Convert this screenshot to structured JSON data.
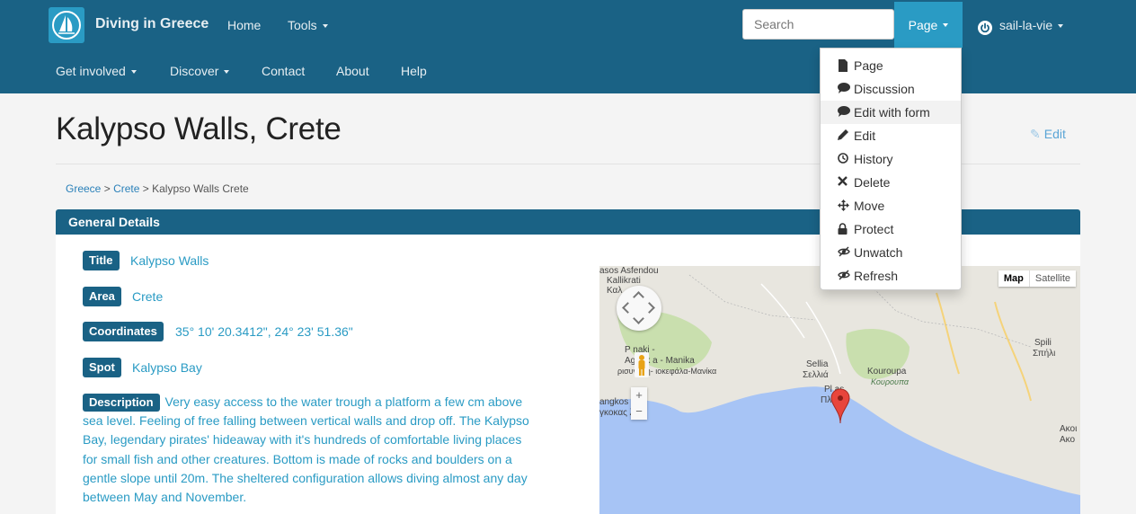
{
  "navbar": {
    "brand": "Diving in Greece",
    "primary": [
      {
        "label": "Home",
        "has_caret": false
      },
      {
        "label": "Tools",
        "has_caret": true
      }
    ],
    "secondary": [
      {
        "label": "Get involved",
        "has_caret": true
      },
      {
        "label": "Discover",
        "has_caret": true
      },
      {
        "label": "Contact",
        "has_caret": false
      },
      {
        "label": "About",
        "has_caret": false
      },
      {
        "label": "Help",
        "has_caret": false
      }
    ],
    "search_placeholder": "Search",
    "page_button": "Page",
    "user": "sail-la-vie"
  },
  "page_menu": {
    "items": [
      {
        "label": "Page",
        "icon": "file-icon"
      },
      {
        "label": "Discussion",
        "icon": "comment-icon"
      },
      {
        "label": "Edit with form",
        "icon": "comment-icon",
        "highlighted": true
      },
      {
        "label": "Edit",
        "icon": "pencil-icon"
      },
      {
        "label": "History",
        "icon": "clock-icon"
      },
      {
        "label": "Delete",
        "icon": "remove-icon"
      },
      {
        "label": "Move",
        "icon": "move-icon"
      },
      {
        "label": "Protect",
        "icon": "lock-icon"
      },
      {
        "label": "Unwatch",
        "icon": "eye-slash-icon"
      },
      {
        "label": "Refresh",
        "icon": "eye-slash-icon"
      }
    ]
  },
  "header": {
    "title": "Kalypso Walls, Crete",
    "edit_label": "Edit"
  },
  "breadcrumb": {
    "items": [
      "Greece",
      "Crete",
      "Kalypso Walls Crete"
    ],
    "separator": ">"
  },
  "section": {
    "title": "General Details",
    "fields": {
      "title": {
        "label": "Title",
        "value": "Kalypso Walls"
      },
      "area": {
        "label": "Area",
        "value": "Crete"
      },
      "coordinates": {
        "label": "Coordinates",
        "value": "35° 10' 20.3412\", 24° 23' 51.36\""
      },
      "spot": {
        "label": "Spot",
        "value": "Kalypso Bay"
      },
      "description": {
        "label": "Description",
        "value": "Very easy access to the water trough a platform a few cm above sea level. Feeling of free falling between vertical walls and drop off. The Kalypso Bay, legendary pirates' hideaway with it's hundreds of comfortable living places for small fish and other creatures. Bottom is made of rocks and boulders on a gentle slope until 20m. The sheltered configuration allows diving almost any day between May and November."
      }
    }
  },
  "map": {
    "type_map": "Map",
    "type_satellite": "Satellite",
    "zoom_in": "+",
    "zoom_out": "−",
    "labels": {
      "asfendou": "asos Asfendou",
      "kallikrati": "Kallikrati",
      "kali": "Καλ",
      "peristeraki": "P      naki -",
      "agriokefala": "Agriok      a - Manika",
      "agriokefala_gr": "ρισυνάκη-   ιοκεφάλα-Μανίκα",
      "sellia": "Sellia",
      "sellia_gr": "Σελλιά",
      "kouroupa": "Kouroupa",
      "kouroupa_gr": "Κουρουπα",
      "spili": "Spili",
      "spili_gr": "Σπήλι",
      "plakias": "Pl    as",
      "plakias_gr": "Πλ    ας",
      "angkos": "angkos   llo",
      "angkos_gr": "γκοκας   λλο",
      "akou": "Ακοι",
      "akou_gr": "Ακο"
    },
    "colors": {
      "sea": "#a7c4f5",
      "land": "#e8e6df",
      "forest": "#c9dfae"
    }
  },
  "colors": {
    "navbar": "#1a6285",
    "accent": "#2a9bc4",
    "label_bg": "#1a6285"
  }
}
